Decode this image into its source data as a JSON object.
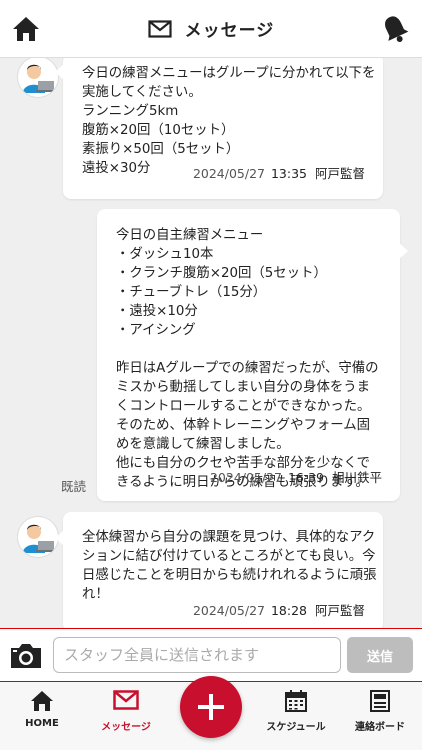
{
  "header": {
    "title": "メッセージ"
  },
  "messages": [
    {
      "text": "今日の練習メニューはグループに分かれて以下を\n実施してください。\nランニング5km\n腹筋×20回（10セット）\n素振り×50回（5セット）\n遠投×30分",
      "date": "2024/05/27",
      "time": "13:35",
      "author": "阿戸監督"
    },
    {
      "text": "今日の自主練習メニュー\n・ダッシュ10本\n・クランチ腹筋×20回（5セット）\n・チューブトレ（15分）\n・遠投×10分\n・アイシング\n\n昨日はAグループでの練習だったが、守備の\nミスから動揺してしまい自分の身体をうま\nくコントロールすることができなかった。\nそのため、体幹トレーニングやフォーム固\nめを意識して練習しました。\n他にも自分のクセや苦手な部分を少なくで\nきるように明日からの練習も頑張ります。",
      "date": "2024/05/27",
      "time": "16:39",
      "author": "相川鉄平",
      "read_label": "既読"
    },
    {
      "text": "全体練習から自分の課題を見つけ、具体的なアク\nションに結び付けているところがとても良い。今\n日感じたことを明日からも続けれれるように頑張\nれ！",
      "date": "2024/05/27",
      "time": "18:28",
      "author": "阿戸監督"
    }
  ],
  "input": {
    "placeholder": "スタッフ全員に送信されます",
    "value": ""
  },
  "send_label": "送信",
  "tabs": [
    {
      "label": "HOME",
      "icon": "home-icon"
    },
    {
      "label": "メッセージ",
      "icon": "mail-icon",
      "active": true
    },
    {
      "label": "スケジュール",
      "icon": "calendar-icon"
    },
    {
      "label": "連絡ボード",
      "icon": "board-icon"
    }
  ],
  "colors": {
    "accent": "#c8102e",
    "send_disabled": "#bdbdbd"
  }
}
